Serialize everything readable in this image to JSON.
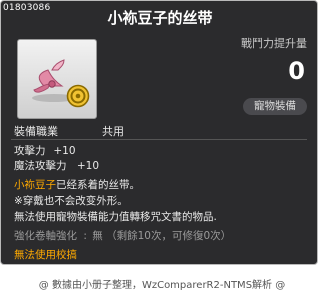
{
  "item": {
    "id": "01803086",
    "name": "小袮豆子的丝带",
    "combat_power_label": "戰鬥力提升量",
    "combat_power_value": "0",
    "tag": "寵物裝備",
    "job_label": "裝備職業",
    "job_value": "共用"
  },
  "stats": [
    {
      "name": "攻擊力",
      "value": "+10"
    },
    {
      "name": "魔法攻擊力",
      "value": "+10"
    }
  ],
  "description": {
    "highlight": "小袮豆子",
    "line1_rest": "已经系着的丝带。",
    "line2": "※穿戴也不会改变外形。",
    "line3": "無法使用寵物裝備能力值轉移咒文書的物品."
  },
  "enhance": {
    "label": "強化卷軸強化",
    "value": "無",
    "remaining": "（剩餘10次，可修復0次）"
  },
  "warning": "無法使用校搞",
  "footer": "@ 數據由小册子整理，WzComparerR2-NTMS解析 @",
  "colors": {
    "panel_bg": "#1e1e20",
    "highlight": "#ffaa00",
    "muted": "#9b9b9b"
  }
}
